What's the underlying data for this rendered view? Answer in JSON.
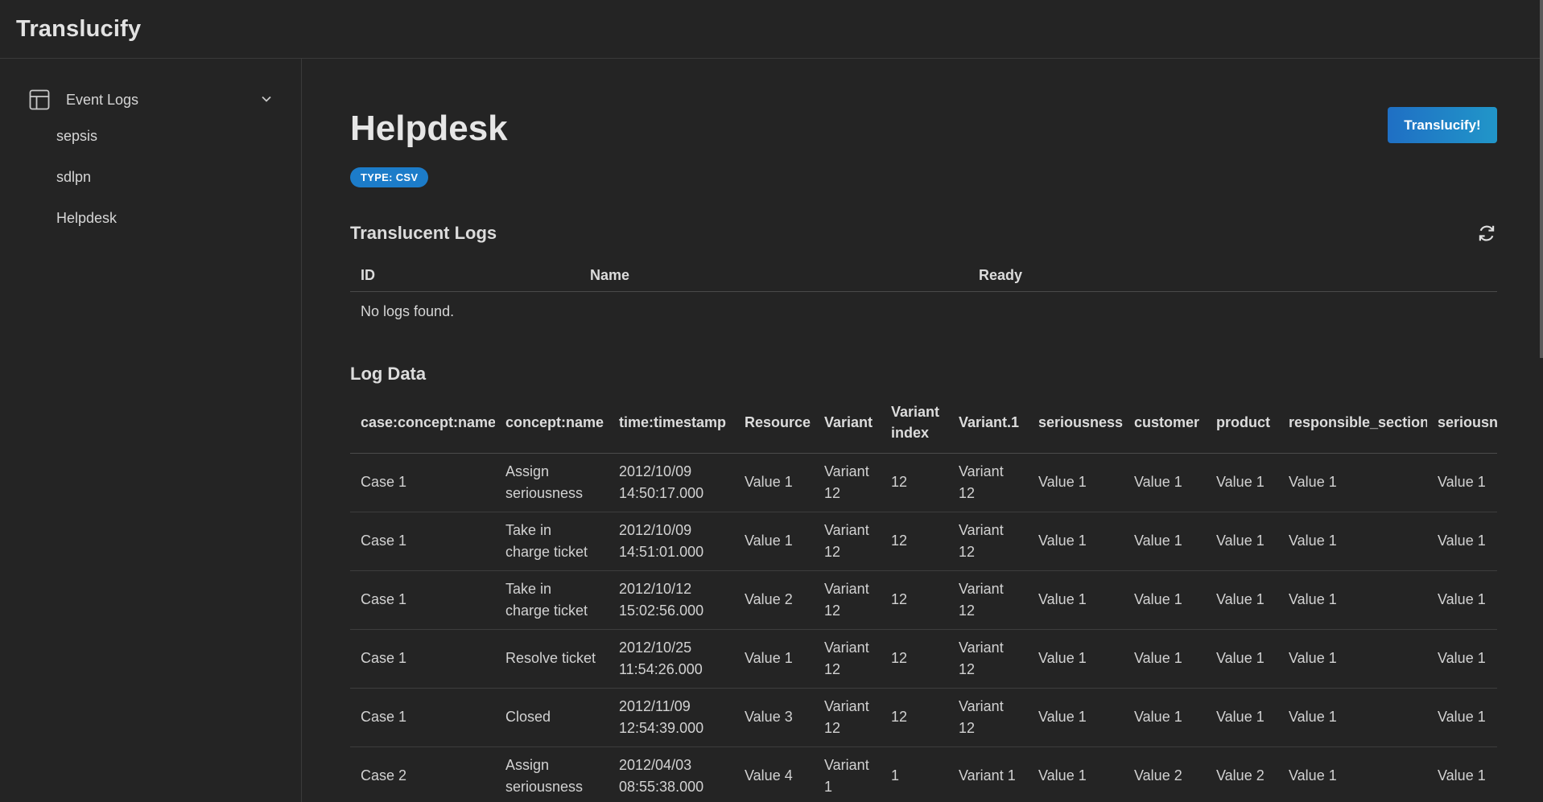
{
  "app": {
    "title": "Translucify"
  },
  "sidebar": {
    "group": {
      "label": "Event Logs",
      "icon": "table-icon",
      "expanded": true
    },
    "items": [
      {
        "label": "sepsis"
      },
      {
        "label": "sdlpn"
      },
      {
        "label": "Helpdesk"
      }
    ]
  },
  "main": {
    "title": "Helpdesk",
    "badge": "TYPE: CSV",
    "cta_label": "Translucify!",
    "translucent": {
      "title": "Translucent Logs",
      "columns": [
        "ID",
        "Name",
        "Ready"
      ],
      "empty_text": "No logs found."
    },
    "log_data": {
      "title": "Log Data",
      "columns": [
        "case:concept:name",
        "concept:name",
        "time:timestamp",
        "Resource",
        "Variant",
        "Variant index",
        "Variant.1",
        "seriousness",
        "customer",
        "product",
        "responsible_section",
        "seriousness"
      ],
      "rows": [
        [
          "Case 1",
          "Assign seriousness",
          "2012/10/09 14:50:17.000",
          "Value 1",
          "Variant 12",
          "12",
          "Variant 12",
          "Value 1",
          "Value 1",
          "Value 1",
          "Value 1",
          "Value 1"
        ],
        [
          "Case 1",
          "Take in charge ticket",
          "2012/10/09 14:51:01.000",
          "Value 1",
          "Variant 12",
          "12",
          "Variant 12",
          "Value 1",
          "Value 1",
          "Value 1",
          "Value 1",
          "Value 1"
        ],
        [
          "Case 1",
          "Take in charge ticket",
          "2012/10/12 15:02:56.000",
          "Value 2",
          "Variant 12",
          "12",
          "Variant 12",
          "Value 1",
          "Value 1",
          "Value 1",
          "Value 1",
          "Value 1"
        ],
        [
          "Case 1",
          "Resolve ticket",
          "2012/10/25 11:54:26.000",
          "Value 1",
          "Variant 12",
          "12",
          "Variant 12",
          "Value 1",
          "Value 1",
          "Value 1",
          "Value 1",
          "Value 1"
        ],
        [
          "Case 1",
          "Closed",
          "2012/11/09 12:54:39.000",
          "Value 3",
          "Variant 12",
          "12",
          "Variant 12",
          "Value 1",
          "Value 1",
          "Value 1",
          "Value 1",
          "Value 1"
        ],
        [
          "Case 2",
          "Assign seriousness",
          "2012/04/03 08:55:38.000",
          "Value 4",
          "Variant 1",
          "1",
          "Variant 1",
          "Value 1",
          "Value 2",
          "Value 2",
          "Value 1",
          "Value 1"
        ]
      ]
    }
  },
  "colors": {
    "background": "#242424",
    "accent": "#1c7cc9",
    "border": "#3a3a3a"
  }
}
